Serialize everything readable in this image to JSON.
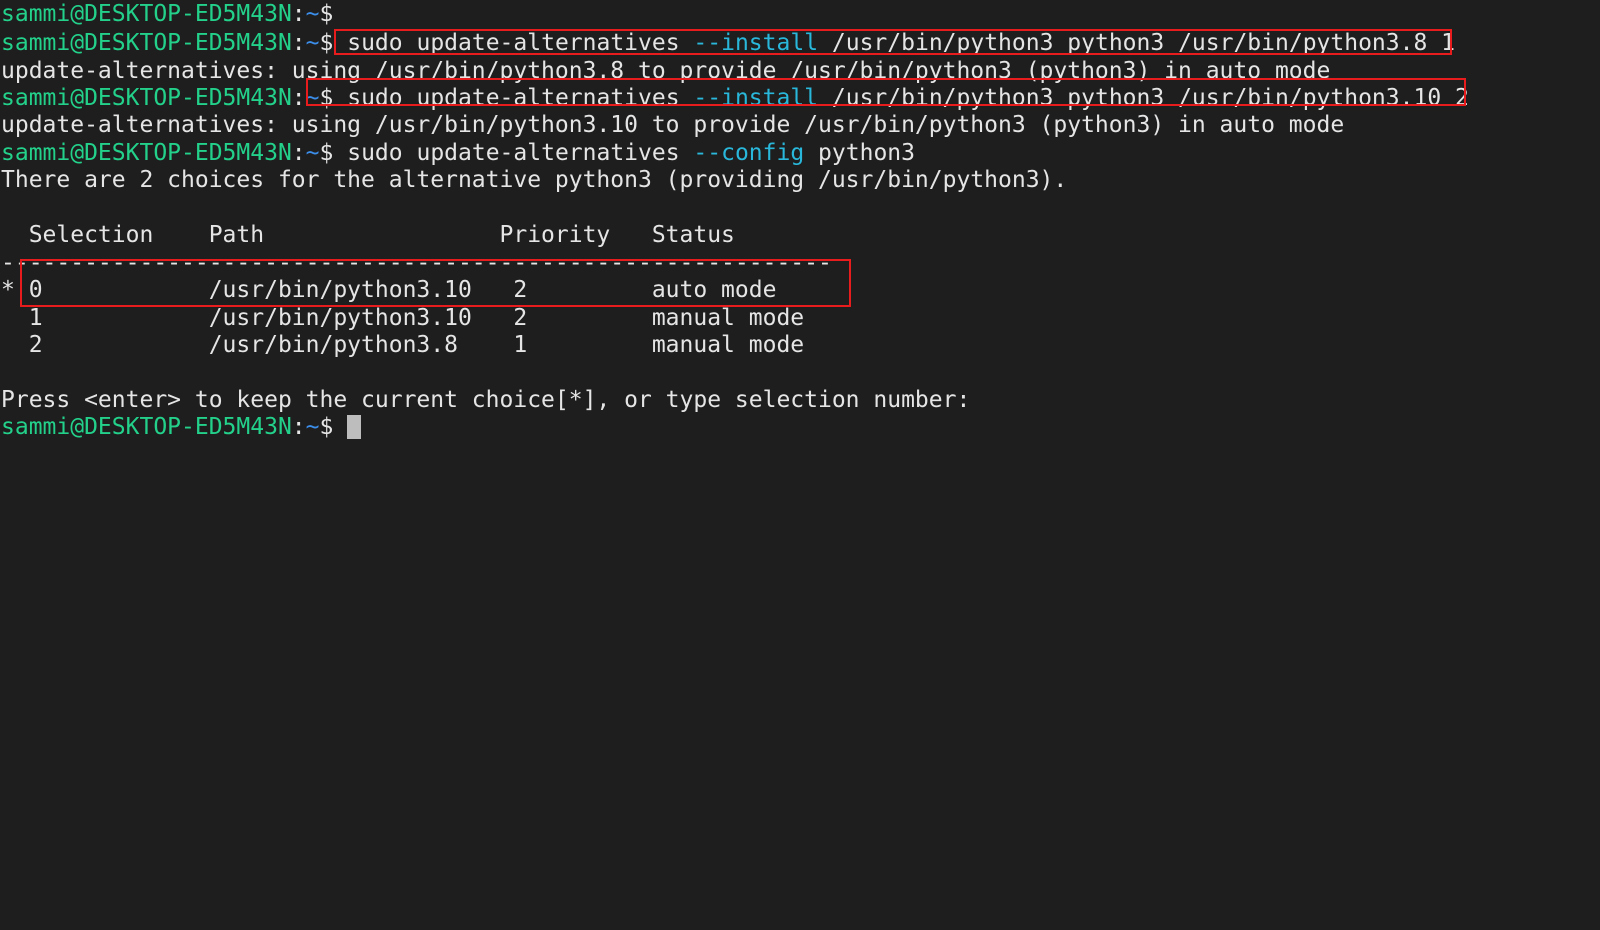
{
  "prompt": {
    "user_host": "sammi@DESKTOP-ED5M43N",
    "separator": ":",
    "path": "~",
    "dollar": "$"
  },
  "lines": {
    "l2": {
      "cmd_a": "sudo update-alternatives ",
      "flag": "--install",
      "cmd_b": " /usr/bin/python3 python3 /usr/bin/python3.8 1"
    },
    "l3": "update-alternatives: using /usr/bin/python3.8 to provide /usr/bin/python3 (python3) in auto mode",
    "l4": {
      "cmd_a": "sudo update-alternatives ",
      "flag": "--install",
      "cmd_b": " /usr/bin/python3 python3 /usr/bin/python3.10 2"
    },
    "l5": "update-alternatives: using /usr/bin/python3.10 to provide /usr/bin/python3 (python3) in auto mode",
    "l6": {
      "cmd_a": "sudo update-alternatives ",
      "flag": "--config",
      "cmd_b": " python3"
    },
    "l7": "There are 2 choices for the alternative python3 (providing /usr/bin/python3).",
    "table_header": "  Selection    Path                 Priority   Status",
    "table_rule": "------------------------------------------------------------",
    "rows": [
      "* 0            /usr/bin/python3.10   2         auto mode",
      "  1            /usr/bin/python3.10   2         manual mode",
      "  2            /usr/bin/python3.8    1         manual mode"
    ],
    "press_enter": "Press <enter> to keep the current choice[*], or type selection number:"
  },
  "colors": {
    "background": "#1e1e1e",
    "prompt_user": "#23d18b",
    "prompt_path": "#3b8eea",
    "flag": "#29b8db",
    "text": "#e5e5e5",
    "highlight_box": "#e81c1c"
  }
}
